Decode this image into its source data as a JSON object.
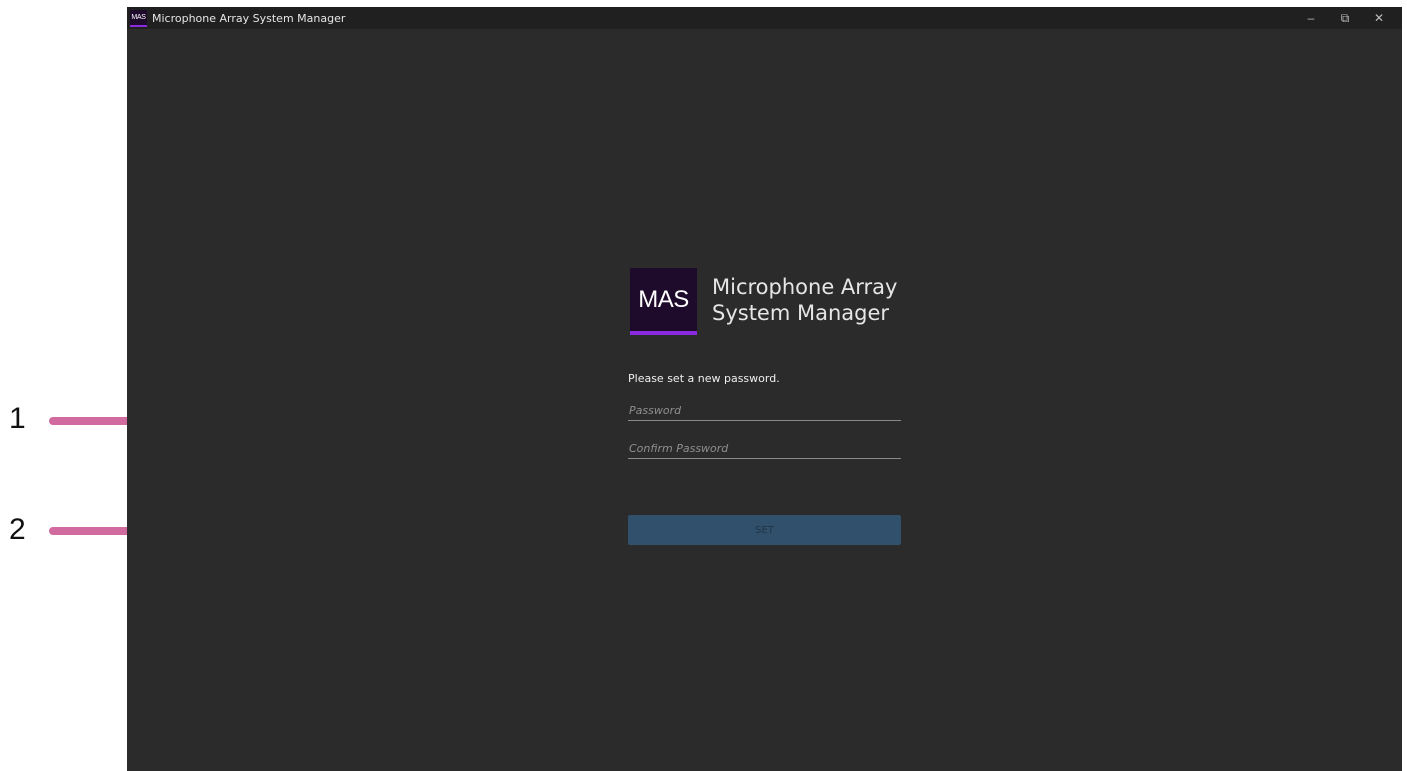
{
  "window": {
    "title": "Microphone Array System Manager",
    "icon_text": "MAS",
    "controls": {
      "minimize": "–",
      "restore": "⧉",
      "close": "✕"
    }
  },
  "brand": {
    "logo_text": "MAS",
    "name_line1": "Microphone Array",
    "name_line2": "System Manager"
  },
  "form": {
    "prompt": "Please set a new password.",
    "password_placeholder": "Password",
    "confirm_placeholder": "Confirm Password",
    "password_value": "",
    "confirm_value": "",
    "submit_label": "SET"
  },
  "callouts": [
    "1",
    "2"
  ],
  "colors": {
    "window_bg": "#2b2b2b",
    "titlebar_bg": "#202020",
    "logo_bg": "#1e0a2b",
    "logo_accent": "#8a2be2",
    "button_bg": "#31506b",
    "callout": "#d06a9f"
  }
}
